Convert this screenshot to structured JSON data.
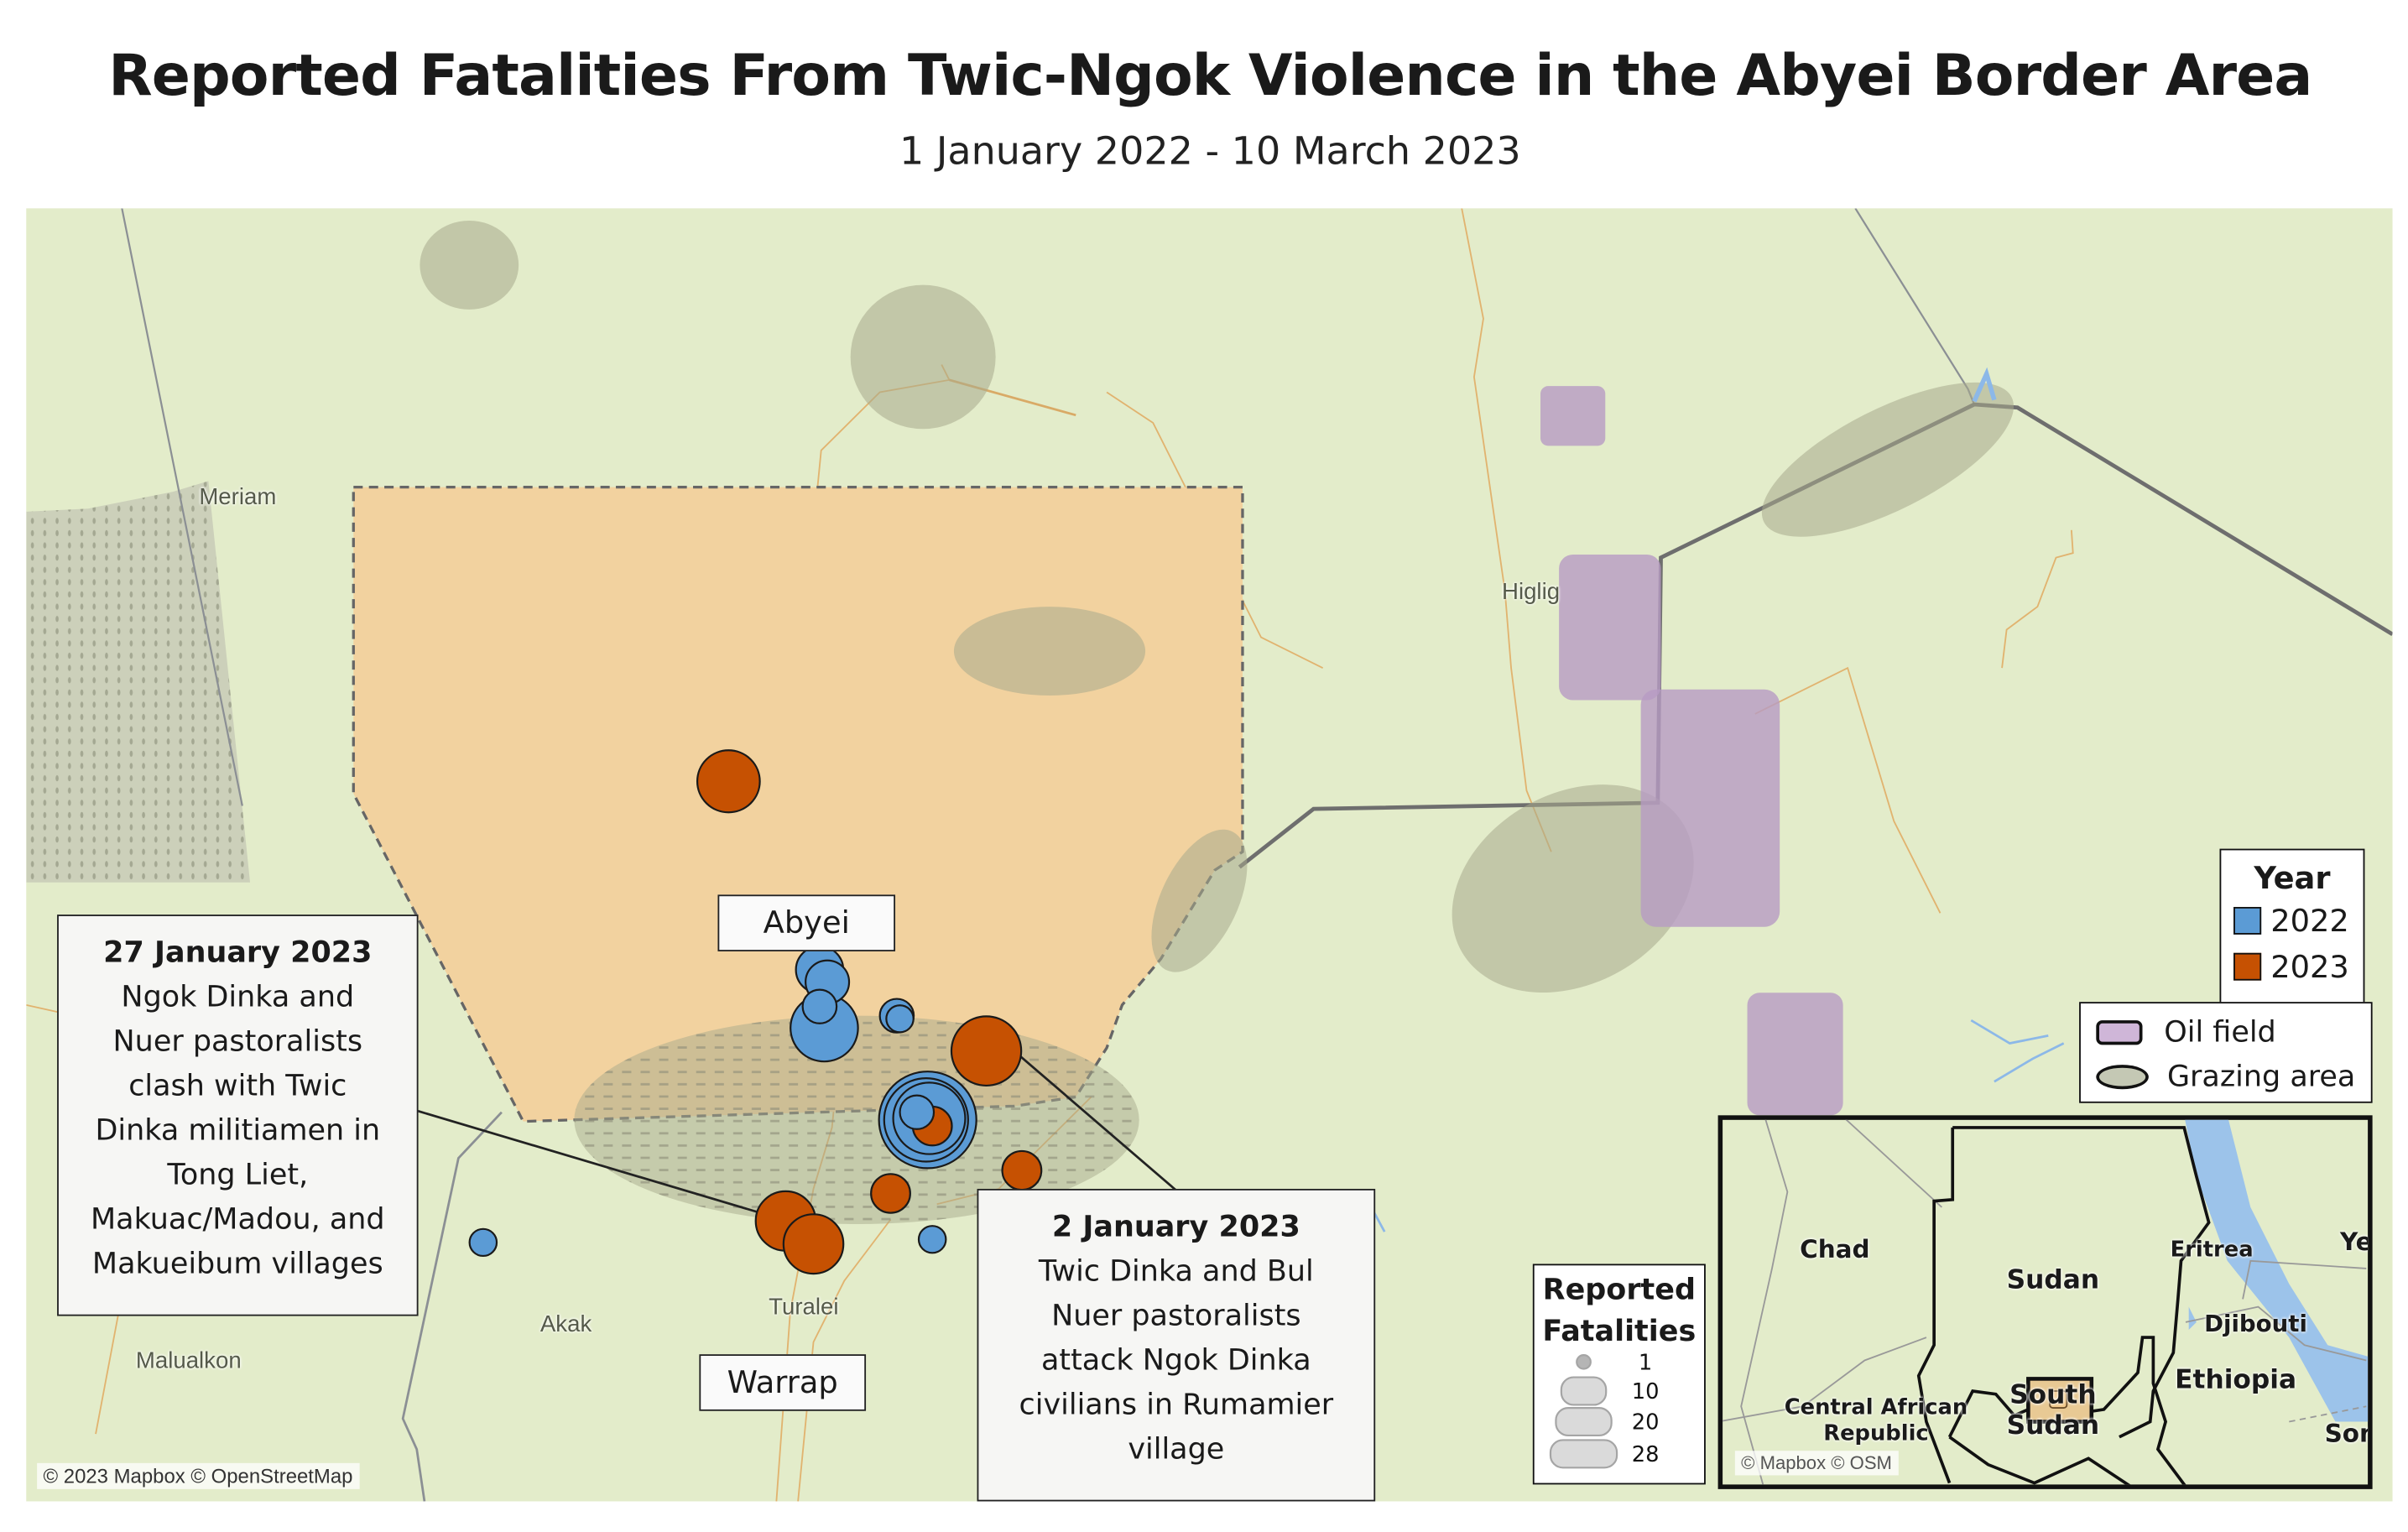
{
  "title": "Reported Fatalities From Twic-Ngok Violence in the Abyei Border Area",
  "subtitle": "1 January 2022 - 10 March 2023",
  "colors": {
    "year_2022": "#5b9bd5",
    "year_2023": "#c65102",
    "abyei_area": "#f2d29f",
    "grazing_area": "#a8a98c",
    "oil_field": "#b79bc3",
    "land": "#e3ecca",
    "water": "#9cc3ea"
  },
  "map": {
    "place_labels": {
      "meriam": "Meriam",
      "higlig": "Higlig",
      "akak": "Akak",
      "turalei": "Turalei",
      "malualkon": "Malualkon"
    },
    "region_labels": {
      "abyei": "Abyei",
      "warrap": "Warrap"
    },
    "attribution": "© 2023 Mapbox © OpenStreetMap"
  },
  "callouts": [
    {
      "date": "27 January 2023",
      "lines": [
        "Ngok Dinka and",
        "Nuer pastoralists",
        "clash with Twic",
        "Dinka militiamen in",
        "Tong Liet,",
        "Makuac/Madou, and",
        "Makueibum villages"
      ]
    },
    {
      "date": "2 January 2023",
      "lines": [
        "Twic Dinka and Bul",
        "Nuer pastoralists",
        "attack Ngok Dinka",
        "civilians in Rumamier",
        "village"
      ]
    }
  ],
  "legend_year": {
    "title": "Year",
    "items": [
      {
        "label": "2022",
        "color": "#5b9bd5"
      },
      {
        "label": "2023",
        "color": "#c65102"
      }
    ]
  },
  "legend_areas": {
    "items": [
      {
        "label": "Oil field",
        "icon": "oil-field-swatch"
      },
      {
        "label": "Grazing area",
        "icon": "grazing-area-swatch"
      }
    ]
  },
  "legend_size": {
    "title_line1": "Reported",
    "title_line2": "Fatalities",
    "items": [
      {
        "label": "1",
        "value": 1
      },
      {
        "label": "10",
        "value": 10
      },
      {
        "label": "20",
        "value": 20
      },
      {
        "label": "28",
        "value": 28
      }
    ]
  },
  "inset": {
    "countries": {
      "chad": "Chad",
      "sudan": "Sudan",
      "eritrea": "Eritrea",
      "yemen_partial": "Ye",
      "djibouti": "Djibouti",
      "ethiopia": "Ethiopia",
      "car_line1": "Central African",
      "car_line2": "Republic",
      "south_sudan_line1": "South",
      "south_sudan_line2": "Sudan",
      "somalia_partial": "Son"
    },
    "attribution": "© Mapbox © OSM"
  },
  "chart_data": {
    "type": "scatter",
    "title": "Reported Fatalities From Twic-Ngok Violence in the Abyei Border Area",
    "subtitle": "1 January 2022 - 10 March 2023",
    "size_encoding": "Reported fatalities",
    "color_encoding": "Year",
    "size_legend_values": [
      1,
      10,
      20,
      28
    ],
    "events": [
      {
        "year": 2023,
        "fatalities": 10,
        "location": "north Abyei"
      },
      {
        "year": 2022,
        "fatalities": 5,
        "location": "north of Abyei town"
      },
      {
        "year": 2022,
        "fatalities": 4,
        "location": "north of Abyei town"
      },
      {
        "year": 2022,
        "fatalities": 2,
        "location": "near Abyei town"
      },
      {
        "year": 2022,
        "fatalities": 12,
        "location": "Abyei town"
      },
      {
        "year": 2022,
        "fatalities": 2,
        "location": "east of Abyei town"
      },
      {
        "year": 2022,
        "fatalities": 1,
        "location": "east of Abyei town"
      },
      {
        "year": 2023,
        "fatalities": 13,
        "location": "Rumamier"
      },
      {
        "year": 2022,
        "fatalities": 28,
        "location": "southern Abyei border"
      },
      {
        "year": 2022,
        "fatalities": 20,
        "location": "southern Abyei border"
      },
      {
        "year": 2022,
        "fatalities": 14,
        "location": "southern Abyei border"
      },
      {
        "year": 2022,
        "fatalities": 2,
        "location": "southern Abyei border"
      },
      {
        "year": 2023,
        "fatalities": 3,
        "location": "southern Abyei border"
      },
      {
        "year": 2023,
        "fatalities": 3,
        "location": "east of border cluster"
      },
      {
        "year": 2023,
        "fatalities": 3,
        "location": "south of border"
      },
      {
        "year": 2023,
        "fatalities": 9,
        "location": "Tong Liet"
      },
      {
        "year": 2023,
        "fatalities": 9,
        "location": "Makuac/Madou"
      },
      {
        "year": 2022,
        "fatalities": 1,
        "location": "north of Turalei"
      },
      {
        "year": 2022,
        "fatalities": 1,
        "location": "west of Turalei"
      }
    ]
  }
}
